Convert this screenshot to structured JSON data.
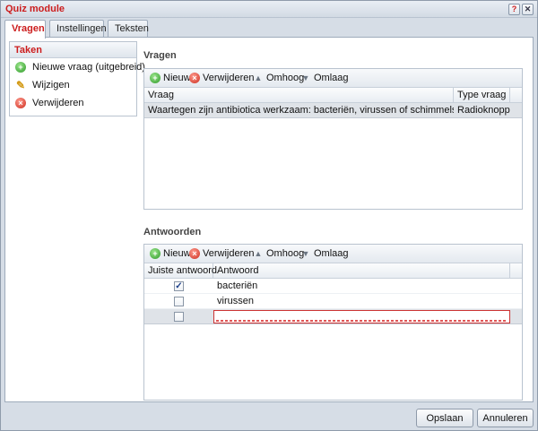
{
  "window": {
    "title": "Quiz module",
    "help_label": "?",
    "close_label": "✕"
  },
  "tabs": [
    {
      "label": "Vragen",
      "active": true
    },
    {
      "label": "Instellingen",
      "active": false
    },
    {
      "label": "Teksten",
      "active": false
    }
  ],
  "sidebar": {
    "title": "Taken",
    "items": [
      {
        "label": "Nieuwe vraag (uitgebreid)",
        "icon": "add-icon"
      },
      {
        "label": "Wijzigen",
        "icon": "pencil-icon"
      },
      {
        "label": "Verwijderen",
        "icon": "delete-icon"
      }
    ]
  },
  "questions": {
    "title": "Vragen",
    "toolbar": {
      "new": "Nieuw",
      "delete": "Verwijderen",
      "up": "Omhoog",
      "down": "Omlaag"
    },
    "columns": [
      "Vraag",
      "Type vraag"
    ],
    "rows": [
      {
        "question": "Waartegen zijn antibiotica werkzaam: bacteriën, virussen of schimmels?",
        "type": "Radioknoppen"
      }
    ]
  },
  "answers": {
    "title": "Antwoorden",
    "toolbar": {
      "new": "Nieuw",
      "delete": "Verwijderen",
      "up": "Omhoog",
      "down": "Omlaag"
    },
    "columns": [
      "Juiste antwoord",
      "Antwoord"
    ],
    "rows": [
      {
        "correct": true,
        "answer": "bacteriën"
      },
      {
        "correct": false,
        "answer": "virussen"
      },
      {
        "correct": false,
        "answer": ""
      }
    ]
  },
  "buttons": {
    "save": "Opslaan",
    "cancel": "Annuleren"
  },
  "colors": {
    "accent": "#cc1d1d",
    "selected_row": "#dfe3e8",
    "edit_border": "#cc3333"
  }
}
